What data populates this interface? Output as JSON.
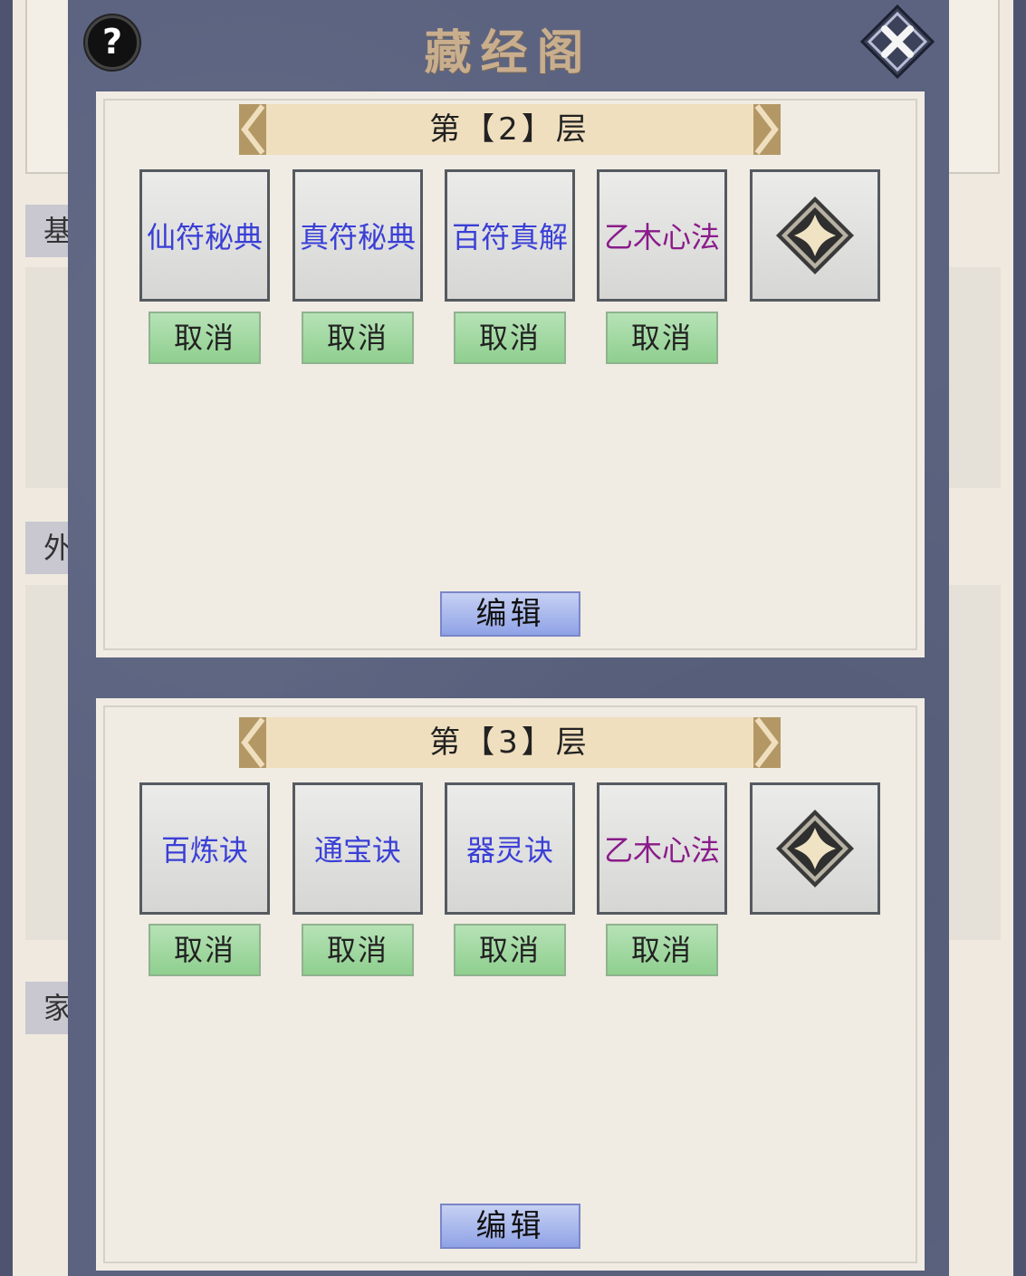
{
  "background": {
    "tabs": [
      "基",
      "外",
      "家"
    ]
  },
  "window": {
    "title": "藏经阁",
    "help_label": "?"
  },
  "floors": [
    {
      "banner": "第【2】层",
      "slots": [
        {
          "name": "仙符秘典",
          "color": "blue"
        },
        {
          "name": "真符秘典",
          "color": "blue"
        },
        {
          "name": "百符真解",
          "color": "blue"
        },
        {
          "name": "乙木心法",
          "color": "purple"
        }
      ],
      "cancel_label": "取消",
      "edit_label": "编辑"
    },
    {
      "banner": "第【3】层",
      "slots": [
        {
          "name": "百炼诀",
          "color": "blue"
        },
        {
          "name": "通宝诀",
          "color": "blue"
        },
        {
          "name": "器灵诀",
          "color": "blue"
        },
        {
          "name": "乙木心法",
          "color": "purple"
        }
      ],
      "cancel_label": "取消",
      "edit_label": "编辑"
    }
  ],
  "colors": {
    "blue_text": "#3a3fd6",
    "purple_text": "#8a1b8a",
    "modal_bg": "#5b6380"
  },
  "icons": {
    "help": "question-icon",
    "close": "close-icon",
    "add": "plus-icon",
    "banner_prev": "chevron-left-icon",
    "banner_next": "chevron-right-icon"
  }
}
